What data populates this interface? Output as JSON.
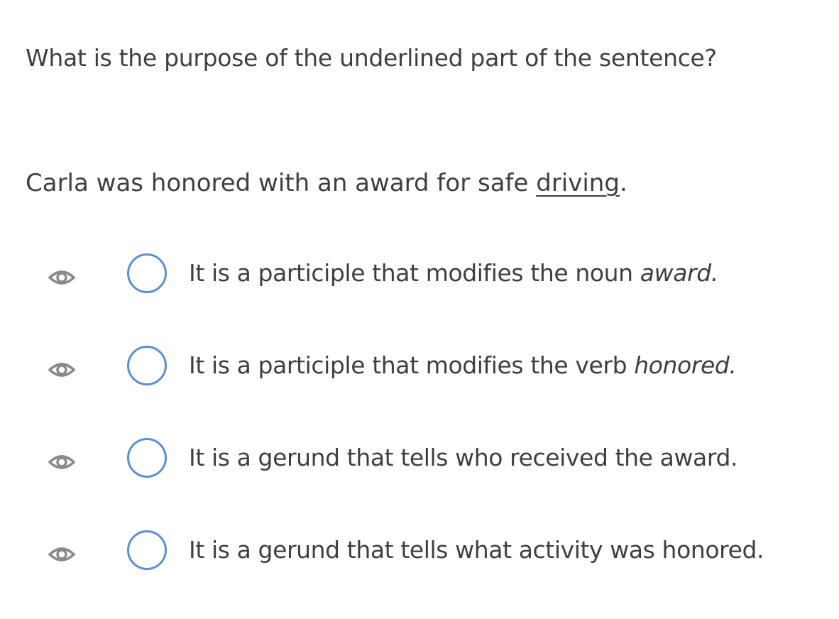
{
  "question": {
    "prompt": "What is the purpose of the underlined part of the sentence?"
  },
  "sentence": {
    "before_underline": "Carla was honored with an award for safe ",
    "underlined": "driving",
    "after_underline": "."
  },
  "options": [
    {
      "text": "It is a participle that modifies the noun ",
      "emphasis": "award.",
      "icon": "eye-icon",
      "selected": false
    },
    {
      "text": "It is a participle that modifies the verb ",
      "emphasis": "honored.",
      "icon": "eye-icon",
      "selected": false
    },
    {
      "text": "It is a gerund that tells who received the award.",
      "emphasis": "",
      "icon": "eye-icon",
      "selected": false
    },
    {
      "text": "It is a gerund that tells what activity was honored.",
      "emphasis": "",
      "icon": "eye-icon",
      "selected": false
    }
  ],
  "colors": {
    "text": "#3f3f3f",
    "radio_border": "#5b8fd6",
    "eye_icon": "#8a8a8a"
  }
}
